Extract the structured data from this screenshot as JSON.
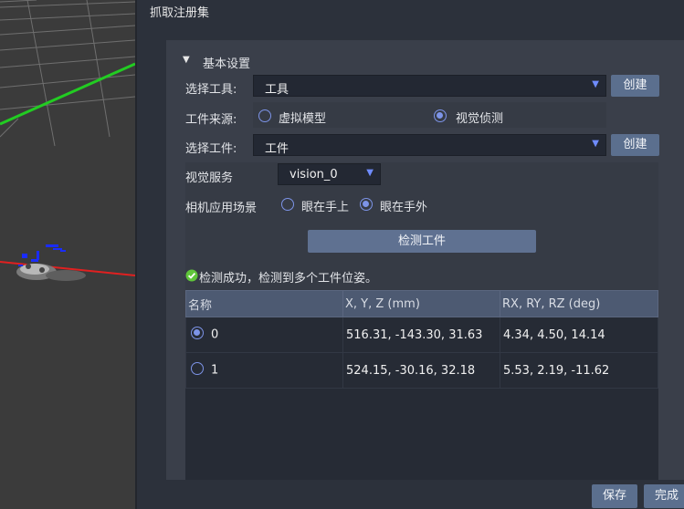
{
  "panel": {
    "title": "抓取注册集"
  },
  "basic": {
    "section_label": "基本设置",
    "tool_label": "选择工具:",
    "tool_value": "工具",
    "create_label": "创建",
    "source_label": "工件来源:",
    "source_options": [
      "虚拟模型",
      "视觉侦测"
    ],
    "source_selected": "视觉侦测",
    "workpiece_label": "选择工件:",
    "workpiece_value": "工件"
  },
  "vision": {
    "service_label": "视觉服务",
    "service_value": "vision_0",
    "scene_label": "相机应用场景",
    "scene_options": [
      "眼在手上",
      "眼在手外"
    ],
    "scene_selected": "眼在手外",
    "detect_button": "检测工件",
    "status_text": "检测成功，检测到多个工件位姿。"
  },
  "table": {
    "headers": [
      "名称",
      "X, Y, Z (mm)",
      "RX, RY, RZ (deg)"
    ],
    "rows": [
      {
        "name": "0",
        "xyz": "516.31, -143.30, 31.63",
        "rxyz": "4.34, 4.50, 14.14",
        "selected": true
      },
      {
        "name": "1",
        "xyz": "524.15, -30.16, 32.18",
        "rxyz": "5.53, 2.19, -11.62",
        "selected": false
      }
    ]
  },
  "footer": {
    "save_label": "保存",
    "done_label": "完成"
  },
  "colors": {
    "accent": "#7d94e8",
    "button": "#5b6f8e",
    "success": "#5fc53a",
    "axis_x": "#e02020",
    "axis_y": "#22cc22",
    "model_text": "#1a2cff"
  }
}
